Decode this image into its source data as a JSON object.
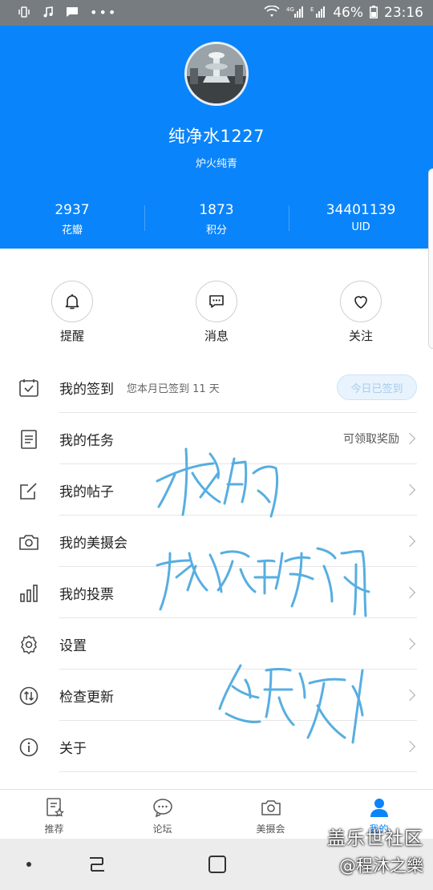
{
  "status_bar": {
    "battery": "46%",
    "time": "23:16",
    "left_icons": [
      "vibrate-icon",
      "music-icon",
      "message-icon",
      "more-dots-icon"
    ],
    "right_icons": [
      "wifi-icon",
      "signal-4g-icon",
      "signal-e-icon",
      "battery-icon"
    ]
  },
  "profile": {
    "username": "纯净水1227",
    "subtitle": "炉火纯青",
    "stats": [
      {
        "value": "2937",
        "label": "花瓣"
      },
      {
        "value": "1873",
        "label": "积分"
      },
      {
        "value": "34401139",
        "label": "UID"
      }
    ]
  },
  "quick_actions": [
    {
      "label": "提醒",
      "icon": "bell-icon"
    },
    {
      "label": "消息",
      "icon": "chat-bubble-icon"
    },
    {
      "label": "关注",
      "icon": "heart-icon"
    }
  ],
  "menu": {
    "checkin": {
      "label": "我的签到",
      "note": "您本月已签到 11 天",
      "button": "今日已签到"
    },
    "tasks": {
      "label": "我的任务",
      "note": "可领取奖励"
    },
    "posts": {
      "label": "我的帖子"
    },
    "photo_club": {
      "label": "我的美摄会"
    },
    "votes": {
      "label": "我的投票"
    },
    "settings": {
      "label": "设置"
    },
    "update": {
      "label": "检查更新"
    },
    "about": {
      "label": "关于"
    }
  },
  "tabbar": {
    "tabs": [
      {
        "label": "推荐",
        "icon": "recommend-icon"
      },
      {
        "label": "论坛",
        "icon": "forum-icon"
      },
      {
        "label": "美摄会",
        "icon": "camera-icon"
      },
      {
        "label": "我的",
        "icon": "person-icon",
        "active": true
      }
    ],
    "active_color": "#0a84fa"
  },
  "watermark": {
    "line1": "盖乐世社区",
    "line2": "@程沐之樂"
  },
  "colors": {
    "header_bg": "#0a84fa",
    "scribble": "#3aa0dc"
  }
}
